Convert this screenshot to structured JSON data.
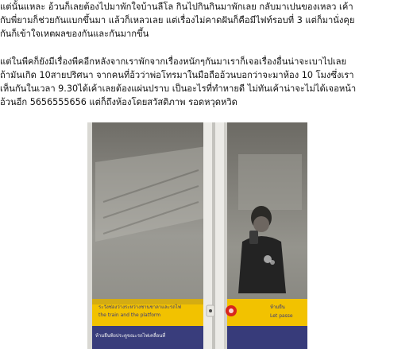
{
  "article": {
    "paragraphs": [
      {
        "lines": [
          "แต่นั้นแหละ อ้วนก็เลยต้องไปมาพักใจบ้านลีโล กินไปกินกินมาพักเลย กลับมาเปนของเหลว เค้า",
          "กับพี่ยามก็ช่วยกันแบกขึ้นมา แล้วก็เหลวเลย แต่เรื่องไม่คาดฝันก็คือมีไฟท์รอบที่ 3 แต่ก็มานั่งคุย",
          "กันก็เข้าใจเหตผลของกันและกันมากขึ้น"
        ]
      },
      {
        "lines": [
          "แต่ในพีคก็ยังมีเรื่องพีคอีกหลังจากเราพักจากเรื่องหนักๆกันมาเราก็เจอเรื่องอื่นน่าจะเบาไปเลย",
          "ถ้ามันเกิด   10สายปริศนา จากคนที่อ้วว่าพ่อโทรมาในมือถืออ้วนบอกว่าจะมาห้อง 10 โมงซึ่งเรา",
          "เห็นกันในเวลา 9.30ได้เค้าเลยต้องแผ่นปราบ เป็นอะไรที่ทำหายดี ไม่ทันเค้าน่าจะไม่ได้เจอหน้า",
          "อ้วนอีก 5656555656 แต่ก็ถึงห้องโดยสวัสดิภาพ รอดหวุดหวิด"
        ]
      }
    ]
  },
  "photo": {
    "sign_left_thai": "ระวังช่องว่างระหว่างชานชาลาและรถไฟ",
    "sign_left_english": "the train and the platform",
    "sign_left_bottom": "ห้ามยืนพิงประตูขณะรถไฟเคลื่อนที่",
    "sign_right_thai": "ห้ามยืน",
    "sign_right_english": "Let passe",
    "colors": {
      "sign_yellow": "#f2c200",
      "sign_blue": "#2a2f7a",
      "frame": "#e9e9e6",
      "glass": "#8e8d86",
      "emergency_red": "#d8261c"
    }
  }
}
